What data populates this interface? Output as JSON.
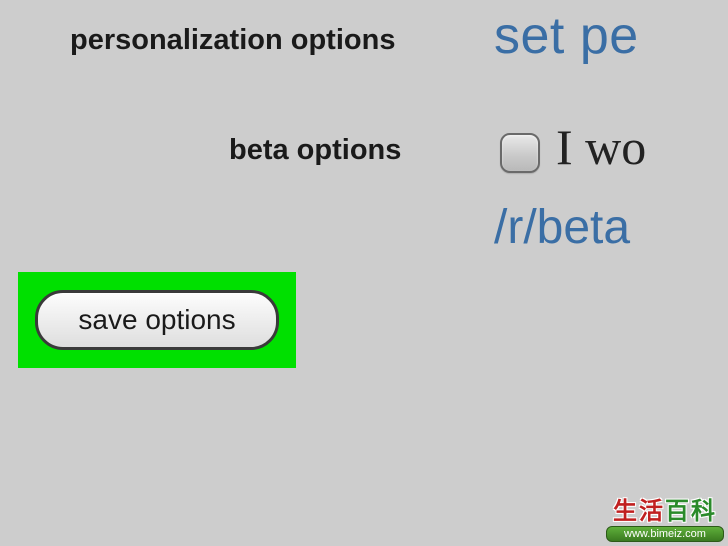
{
  "sections": {
    "personalization": {
      "label": "personalization options",
      "link_fragment": "set pe"
    },
    "beta": {
      "label": "beta options",
      "checkbox_checked": false,
      "text_fragment": "I wo",
      "subreddit_link": "/r/beta"
    }
  },
  "actions": {
    "save_label": "save options"
  },
  "highlight": {
    "color": "#00e000"
  },
  "watermark": {
    "line1_a": "生活",
    "line1_b": "百科",
    "url": "www.bimeiz.com"
  }
}
